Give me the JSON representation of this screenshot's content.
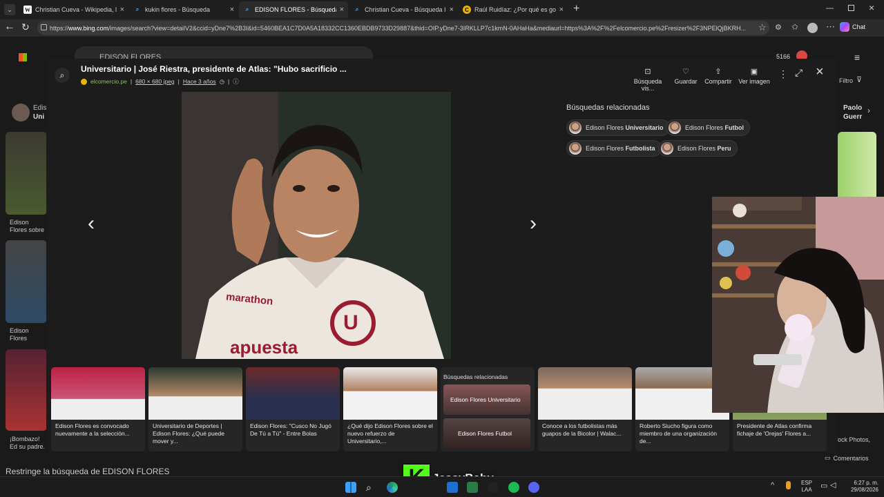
{
  "tabs": [
    {
      "label": "Christian Cueva - Wikipedia, la enc",
      "icon": "wikipedia-icon",
      "active": false
    },
    {
      "label": "kukin flores - Búsqueda",
      "icon": "bing-search-icon",
      "active": false
    },
    {
      "label": "EDISON FLORES - Búsqueda Imág",
      "icon": "bing-search-icon",
      "active": true
    },
    {
      "label": "Christian Cueva - Búsqueda Imág",
      "icon": "bing-search-icon",
      "active": false
    },
    {
      "label": "Raúl Ruidíaz: ¿Por qué es goleado",
      "icon": "elcomercio-icon",
      "active": false
    }
  ],
  "address": {
    "prefix": "https://",
    "domain": "www.bing.com",
    "path": "/images/search?view=detailV2&ccid=yDne7%2B3I&id=5460BEA1C7D0A5A18332CC1360EBDB9733D29887&thid=OIP.yDne7-3IRKLLP7c1kmN-0AHaHa&mediaurl=https%3A%2F%2Felcomercio.pe%2Fresizer%2F3NPElQjBKRH..."
  },
  "browser": {
    "chat_label": "Chat"
  },
  "background_page": {
    "search_query": "EDISON FLORES",
    "rewards": "5166",
    "filter_label": "Filtro",
    "left_cards": [
      {
        "caption": "Edison Flores sobre Bolivia"
      },
      {
        "caption": "Edison Flores importantes q"
      },
      {
        "caption": "¡Bombazo! Ed su padre. \"El"
      }
    ],
    "left_chip": {
      "line1": "Edis",
      "line2": "Uni"
    },
    "right_chip": {
      "line1": "Paolo",
      "line2": "Guerr"
    },
    "right_caption": "ock Photos,",
    "bottom_text": "Restringe la búsqueda de EDISON FLORES",
    "comments_label": "Comentarios"
  },
  "viewer": {
    "title": "Universitario | José Riestra, presidente de Atlas: \"Hubo sacrificio ...",
    "source": "elcomercio.pe",
    "dimensions": "680 × 680 jpeg",
    "age": "Hace 3 años",
    "actions": [
      {
        "label": "Búsqueda vis...",
        "icon": "visual-search-icon"
      },
      {
        "label": "Guardar",
        "icon": "save-icon"
      },
      {
        "label": "Compartir",
        "icon": "share-icon"
      },
      {
        "label": "Ver imagen",
        "icon": "view-image-icon"
      }
    ],
    "related_title": "Búsquedas relacionadas",
    "related": [
      {
        "prefix": "Edison Flores ",
        "bold": "Universitario"
      },
      {
        "prefix": "Edison Flores ",
        "bold": "Futbol"
      },
      {
        "prefix": "Edison Flores ",
        "bold": "Futbolista"
      },
      {
        "prefix": "Edison Flores ",
        "bold": "Peru"
      }
    ],
    "thumbs": [
      {
        "caption": "Edison Flores es convocado nuevamente a la selección..."
      },
      {
        "caption": "Universitario de Deportes | Edison Flores: ¿Qué puede mover y..."
      },
      {
        "caption": "Edison Flores: \"Cusco No Jugó De Tú a Tú\" - Entre Bolas"
      },
      {
        "caption": "¿Qué dijo Edison Flores sobre el nuevo refuerzo de Universitario,..."
      },
      {
        "caption": "Conoce a los futbolistas más guapos de la Bicolor | Walac..."
      },
      {
        "caption": "Roberto Siucho figura como miembro de una organización de..."
      },
      {
        "caption": "Presidente de Atlas confirma fichaje de 'Orejas' Flores a..."
      }
    ],
    "related_card": {
      "title": "Búsquedas relacionadas",
      "item1": "Edison Flores Universitario",
      "item2": "Edison Flores Futbol"
    },
    "jersey_brand": "marathon",
    "jersey_sponsor": "apuesta"
  },
  "overlay": {
    "streamer_name": "JessyBaby",
    "kick_letter": "K"
  },
  "taskbar": {
    "lang_top": "ESP",
    "lang_bottom": "LAA",
    "time": "6:27 p. m.",
    "date": "29/08/2026"
  }
}
